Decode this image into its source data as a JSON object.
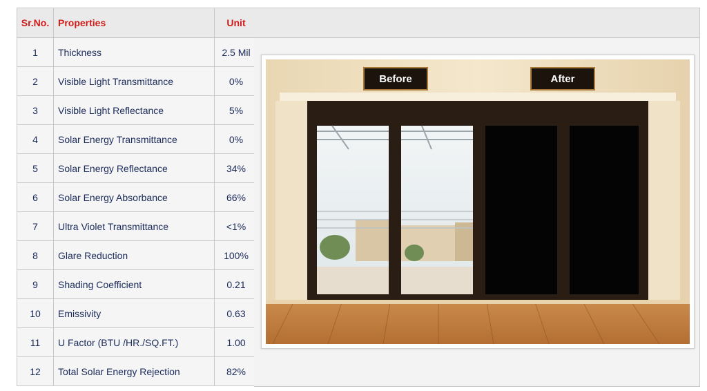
{
  "table": {
    "headers": {
      "sr_no": "Sr.No.",
      "properties": "Properties",
      "unit": "Unit"
    },
    "rows": [
      {
        "sr": "1",
        "property": "Thickness",
        "unit": "2.5 Mil"
      },
      {
        "sr": "2",
        "property": "Visible Light Transmittance",
        "unit": "0%"
      },
      {
        "sr": "3",
        "property": "Visible Light Reflectance",
        "unit": "5%"
      },
      {
        "sr": "4",
        "property": "Solar Energy Transmittance",
        "unit": "0%"
      },
      {
        "sr": "5",
        "property": "Solar Energy Reflectance",
        "unit": "34%"
      },
      {
        "sr": "6",
        "property": "Solar Energy Absorbance",
        "unit": "66%"
      },
      {
        "sr": "7",
        "property": "Ultra Violet Transmittance",
        "unit": "<1%"
      },
      {
        "sr": "8",
        "property": "Glare Reduction",
        "unit": "100%"
      },
      {
        "sr": "9",
        "property": "Shading Coefficient",
        "unit": "0.21"
      },
      {
        "sr": "10",
        "property": "Emissivity",
        "unit": "0.63"
      },
      {
        "sr": "11",
        "property": "U Factor (BTU /HR./SQ.FT.)",
        "unit": "1.00"
      },
      {
        "sr": "12",
        "property": "Total Solar Energy Rejection",
        "unit": "82%"
      }
    ]
  },
  "photo": {
    "before_label": "Before",
    "after_label": "After"
  },
  "colors": {
    "header_text": "#d11a1a",
    "body_text": "#1a2a5a",
    "header_bg": "#eaeaea",
    "cell_bg": "#f5f5f5",
    "border": "#c8c8c8"
  }
}
